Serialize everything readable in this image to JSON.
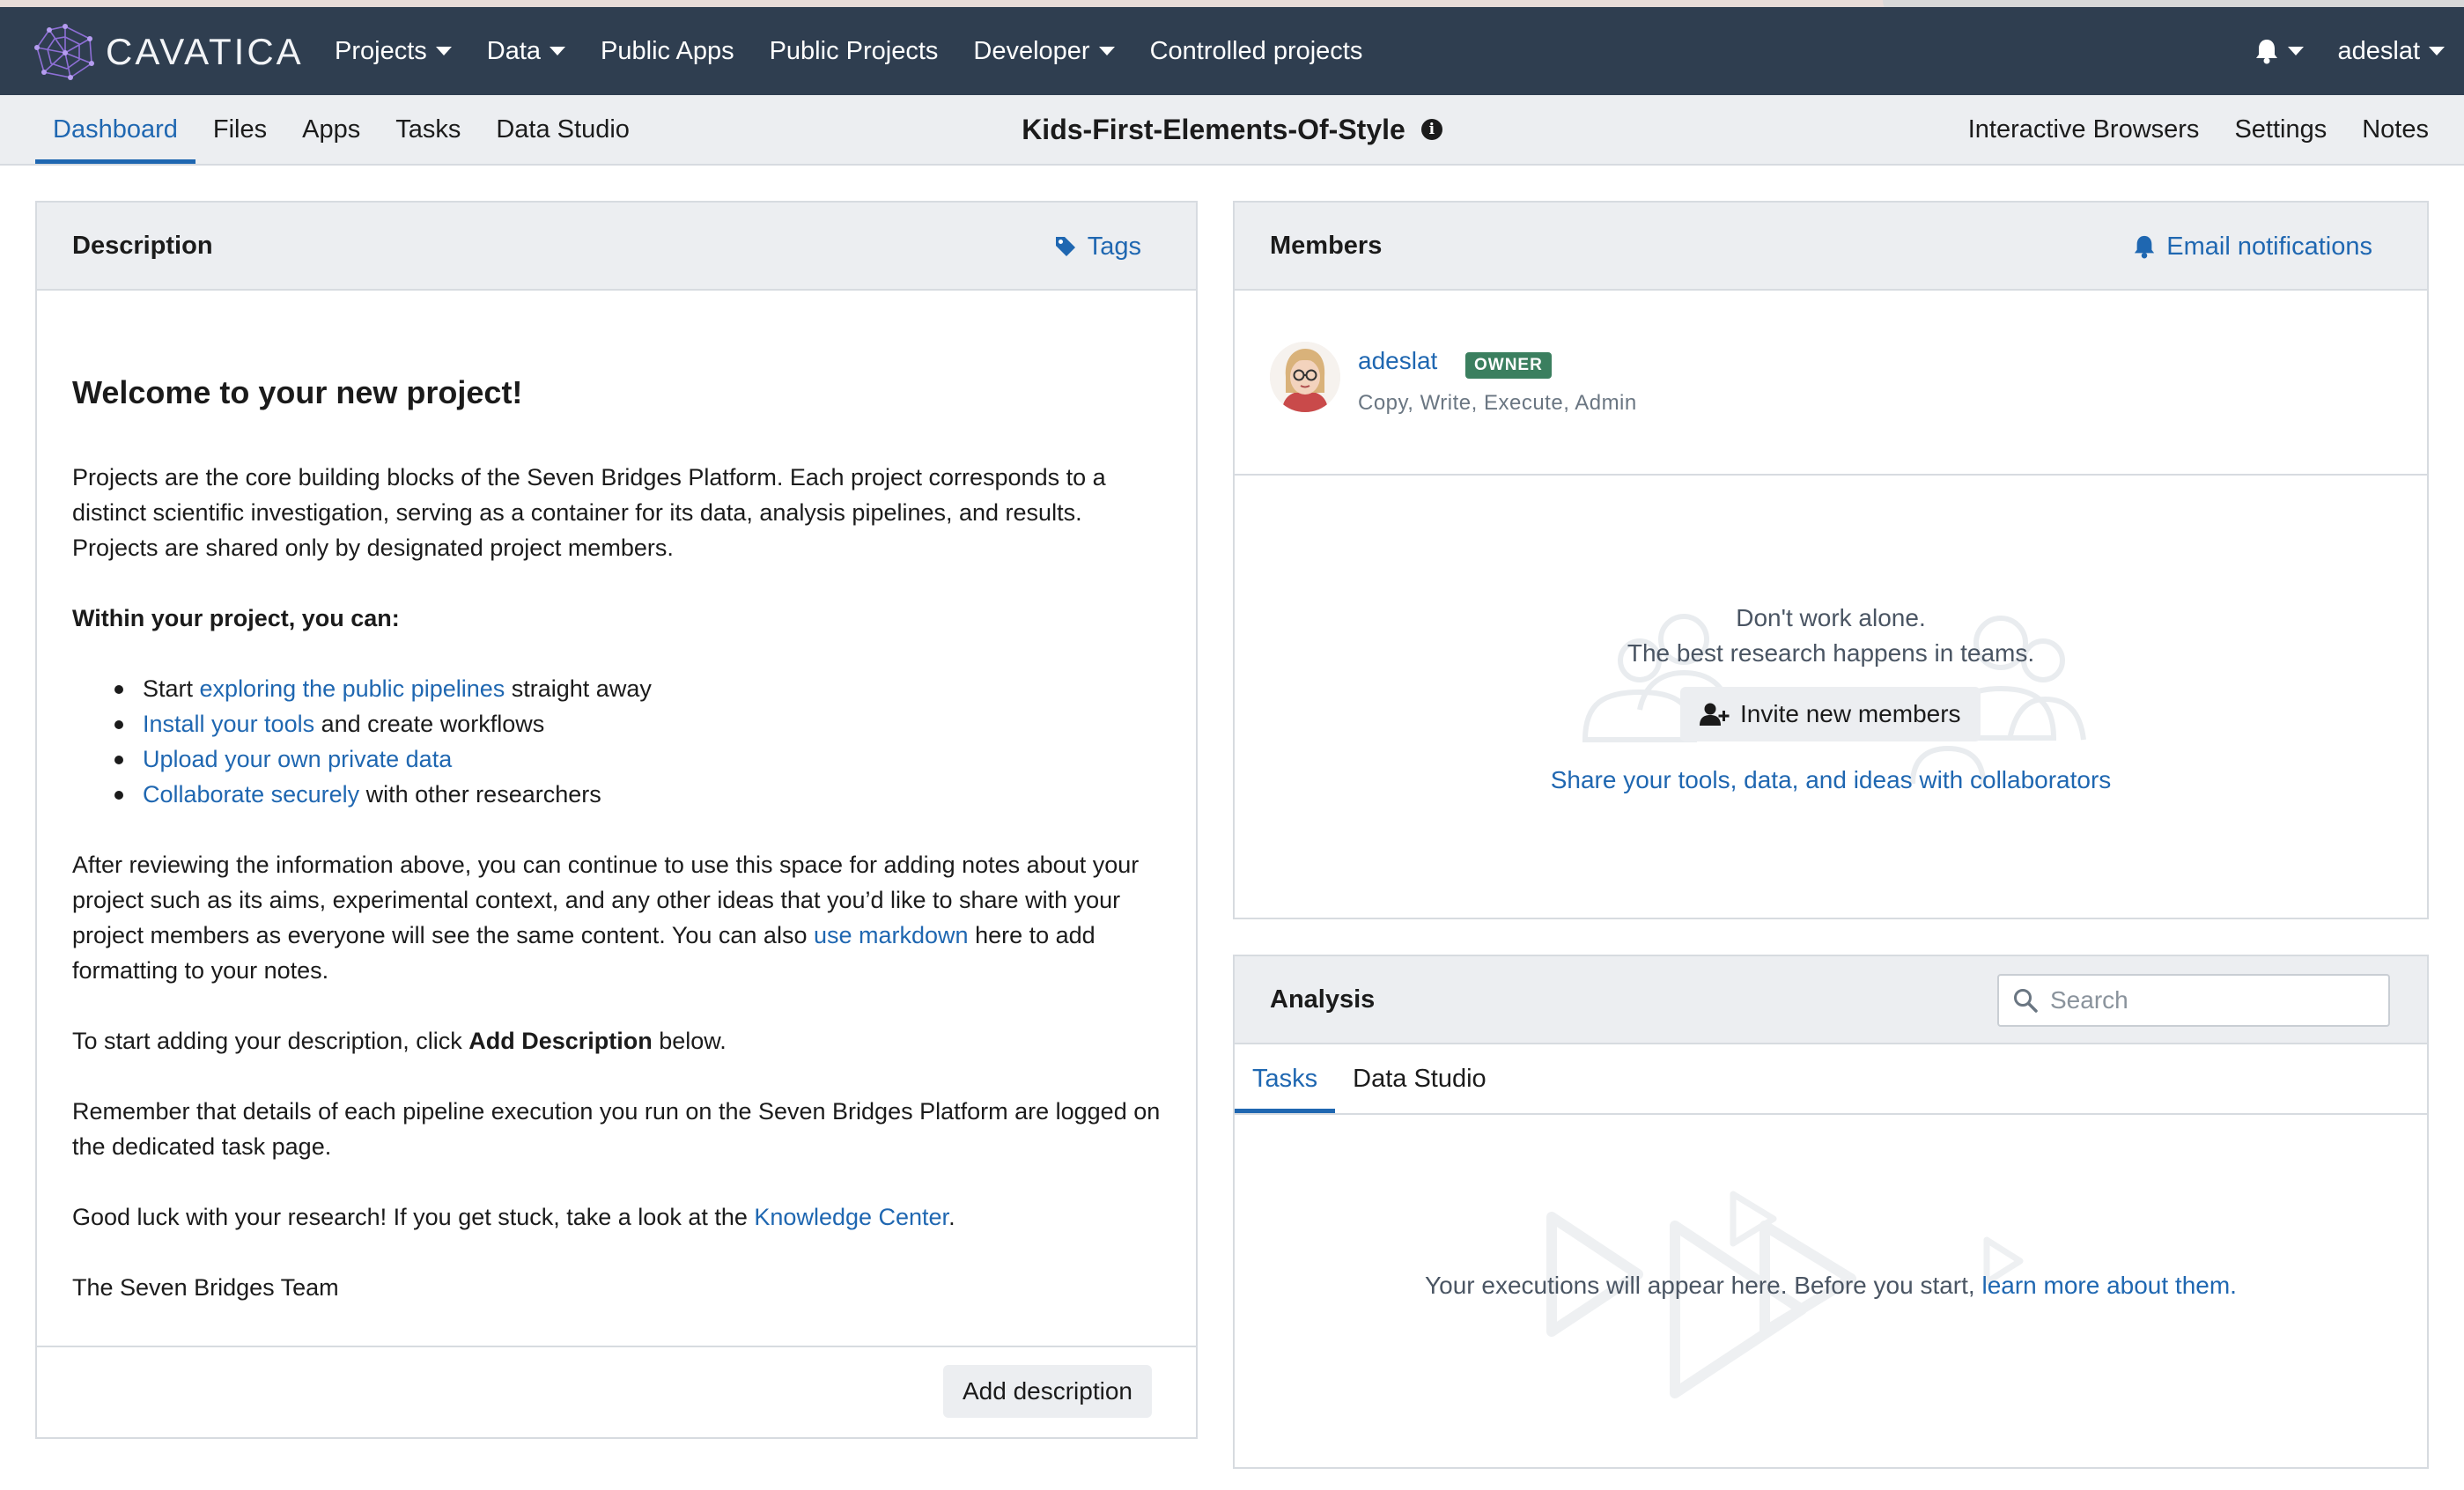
{
  "navbar": {
    "logo_text": "CAVATICA",
    "menu": [
      {
        "label": "Projects",
        "dropdown": true
      },
      {
        "label": "Data",
        "dropdown": true
      },
      {
        "label": "Public Apps",
        "dropdown": false
      },
      {
        "label": "Public Projects",
        "dropdown": false
      },
      {
        "label": "Developer",
        "dropdown": true
      },
      {
        "label": "Controlled projects",
        "dropdown": false
      }
    ],
    "username": "adeslat",
    "notifications_icon": "bell-icon"
  },
  "subnav": {
    "tabs": [
      "Dashboard",
      "Files",
      "Apps",
      "Tasks",
      "Data Studio"
    ],
    "active_tab": "Dashboard",
    "project_title": "Kids-First-Elements-Of-Style",
    "right_tabs": [
      "Interactive Browsers",
      "Settings",
      "Notes"
    ]
  },
  "description": {
    "title": "Description",
    "tags_label": "Tags",
    "heading": "Welcome to your new project!",
    "intro": "Projects are the core building blocks of the Seven Bridges Platform. Each project corresponds to a distinct scientific investigation, serving as a container for its data, analysis pipelines, and results. Projects are shared only by designated project members.",
    "within_heading": "Within your project, you can:",
    "bullets": [
      {
        "pre": "Start ",
        "link": "exploring the public pipelines",
        "post": " straight away"
      },
      {
        "pre": "",
        "link": "Install your tools",
        "post": " and create workflows"
      },
      {
        "pre": "",
        "link": "Upload your own private data",
        "post": ""
      },
      {
        "pre": "",
        "link": "Collaborate securely",
        "post": " with other researchers"
      }
    ],
    "after_pre": "After reviewing the information above, you can continue to use this space for adding notes about your project such as its aims, experimental context, and any other ideas that you’d like to share with your project members as everyone will see the same content. You can also ",
    "after_link": "use markdown",
    "after_post": " here to add formatting to your notes.",
    "start_pre": "To start adding your description, click ",
    "start_bold": "Add Description",
    "start_post": " below.",
    "remember": "Remember that details of each pipeline execution you run on the Seven Bridges Platform are logged on the dedicated task page.",
    "luck_pre": "Good luck with your research! If you get stuck, take a look at the ",
    "luck_link": "Knowledge Center",
    "luck_post": ".",
    "signoff": "The Seven Bridges Team",
    "add_button": "Add description"
  },
  "members": {
    "title": "Members",
    "email_notifications_label": "Email notifications",
    "list": [
      {
        "name": "adeslat",
        "role": "OWNER",
        "permissions": "Copy, Write, Execute, Admin"
      }
    ],
    "empty_line1": "Don't work alone.",
    "empty_line2": "The best research happens in teams.",
    "invite_button": "Invite new members",
    "share_link": "Share your tools, data, and ideas with collaborators"
  },
  "analysis": {
    "title": "Analysis",
    "search_placeholder": "Search",
    "tabs": [
      "Tasks",
      "Data Studio"
    ],
    "active_tab": "Tasks",
    "empty_text": "Your executions will appear here. Before you start, ",
    "empty_link": "learn more about them."
  },
  "colors": {
    "navbar_bg": "#2f3e50",
    "accent": "#1f67b1",
    "owner_badge": "#3b7f5f",
    "panel_header_bg": "#eceef1"
  }
}
